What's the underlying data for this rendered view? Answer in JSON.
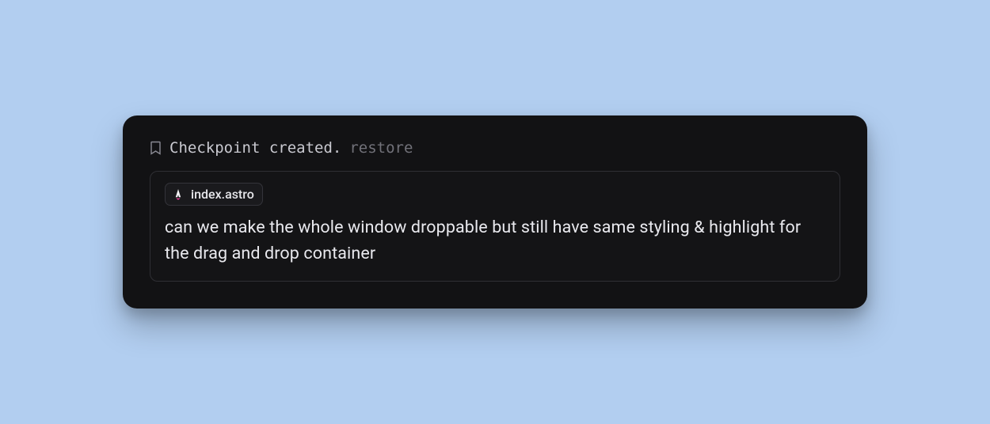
{
  "checkpoint": {
    "status_text": "Checkpoint created.",
    "restore_label": "restore"
  },
  "message": {
    "file_chip": {
      "icon": "astro-icon",
      "label": "index.astro"
    },
    "text": "can we make the whole window droppable but still have  same styling & highlight for the drag and drop container"
  }
}
